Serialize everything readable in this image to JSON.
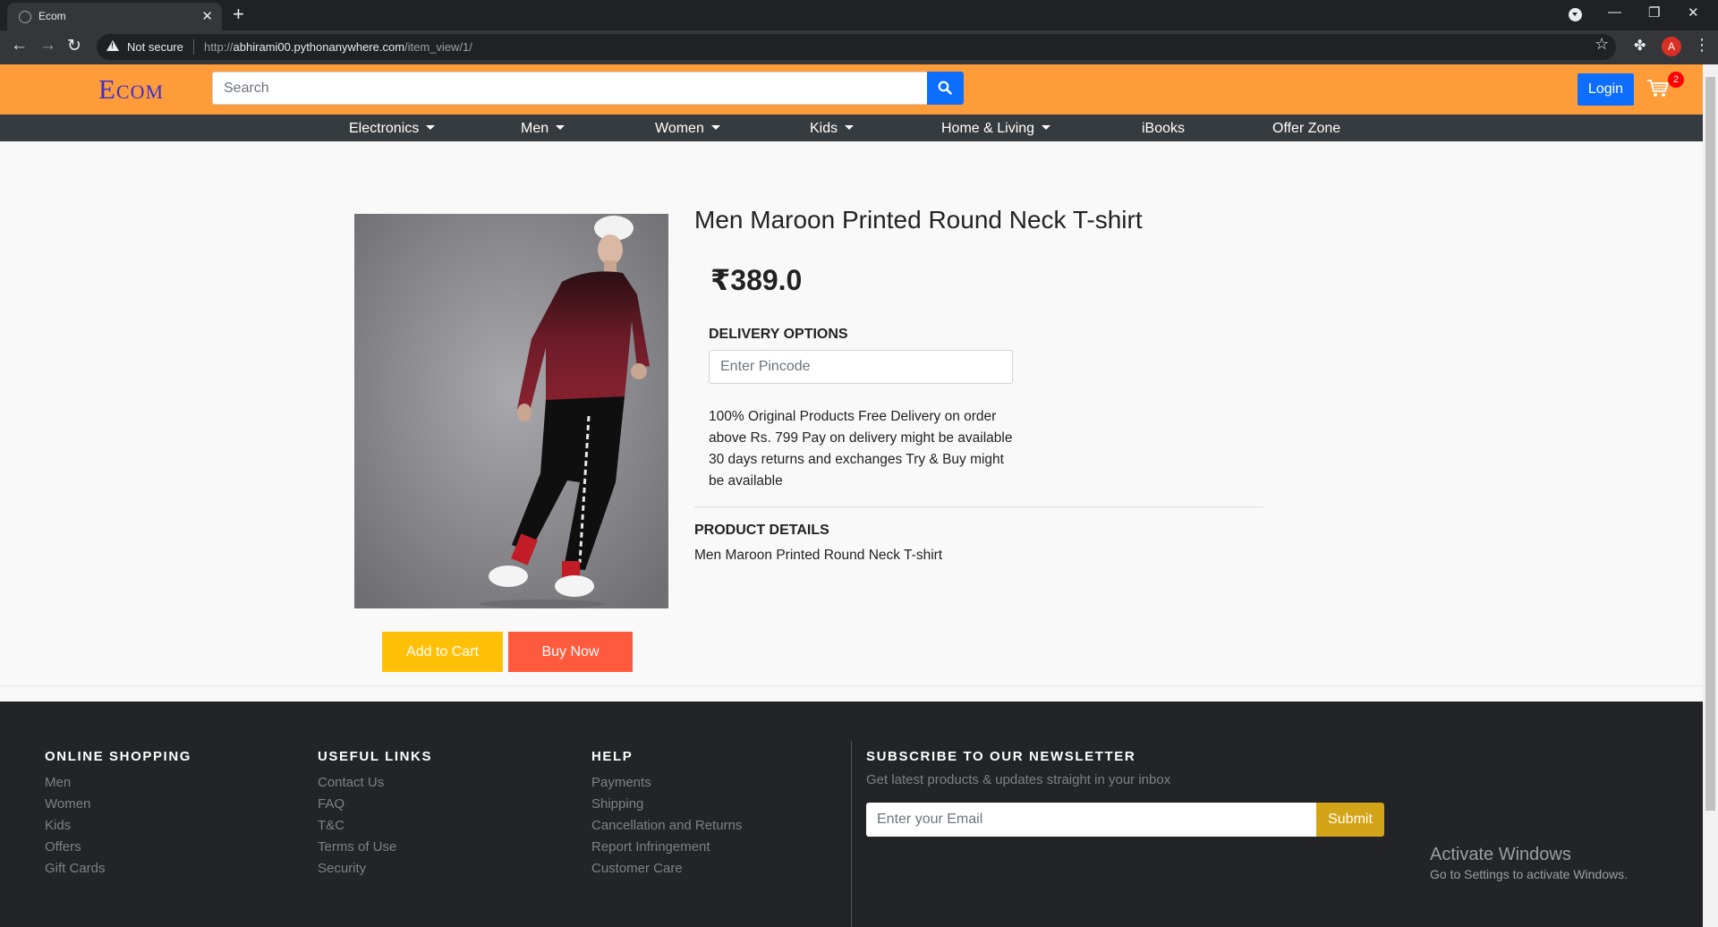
{
  "browser": {
    "tab_title": "Ecom",
    "not_secure": "Not secure",
    "url_scheme": "http://",
    "url_host": "abhirami00.pythonanywhere.com",
    "url_path": "/item_view/1/",
    "profile_initial": "A"
  },
  "header": {
    "logo": "Ecom",
    "search_placeholder": "Search",
    "login_label": "Login",
    "cart_count": "2"
  },
  "nav": {
    "items": [
      {
        "label": "Electronics",
        "dropdown": true
      },
      {
        "label": "Men",
        "dropdown": true
      },
      {
        "label": "Women",
        "dropdown": true
      },
      {
        "label": "Kids",
        "dropdown": true
      },
      {
        "label": "Home & Living",
        "dropdown": true
      },
      {
        "label": "iBooks",
        "dropdown": false
      },
      {
        "label": "Offer Zone",
        "dropdown": false
      }
    ]
  },
  "product": {
    "title": "Men Maroon Printed Round Neck T-shirt",
    "price": "₹389.0",
    "delivery_heading": "DELIVERY OPTIONS",
    "pincode_placeholder": "Enter Pincode",
    "delivery_text": "100% Original Products Free Delivery on order above Rs. 799 Pay on delivery might be available 30 days returns and exchanges Try & Buy might be available",
    "details_heading": "PRODUCT DETAILS",
    "details_text": "Men Maroon Printed Round Neck T-shirt",
    "add_to_cart": "Add to Cart",
    "buy_now": "Buy Now"
  },
  "footer": {
    "online_shopping": {
      "heading": "ONLINE SHOPPING",
      "links": [
        "Men",
        "Women",
        "Kids",
        "Offers",
        "Gift Cards"
      ]
    },
    "useful_links": {
      "heading": "USEFUL LINKS",
      "links": [
        "Contact Us",
        "FAQ",
        "T&C",
        "Terms of Use",
        "Security"
      ]
    },
    "help": {
      "heading": "HELP",
      "links": [
        "Payments",
        "Shipping",
        "Cancellation and Returns",
        "Report Infringement",
        "Customer Care"
      ]
    },
    "newsletter": {
      "heading": "SUBSCRIBE TO OUR NEWSLETTER",
      "subtext": "Get latest products & updates straight in your inbox",
      "email_placeholder": "Enter your Email",
      "submit_label": "Submit"
    }
  },
  "watermark": {
    "line1": "Activate Windows",
    "line2": "Go to Settings to activate Windows."
  },
  "colors": {
    "header_orange": "#ff9c3a",
    "nav_dark": "#363b3f",
    "footer_dark": "#222427",
    "primary_blue": "#0d6efd",
    "cart_button": "#ffc107",
    "buy_button": "#ff5a3d",
    "submit_button": "#d4a418"
  }
}
